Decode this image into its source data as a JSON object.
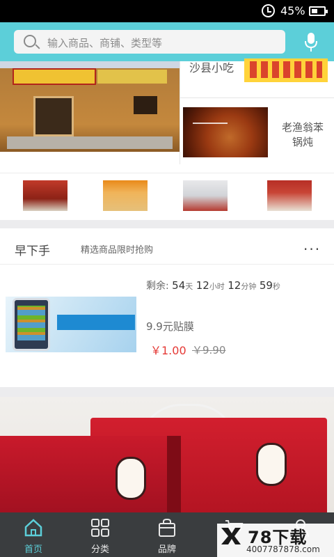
{
  "status_bar": {
    "battery": "45%"
  },
  "search": {
    "placeholder": "输入商品、商铺、类型等"
  },
  "shops": {
    "top_label": "沙县小吃",
    "side_label": "老渔翁苯锅炖"
  },
  "flash_sale": {
    "title": "早下手",
    "subtitle": "精选商品限时抢购",
    "more": "···",
    "countdown": {
      "prefix": "剩余:",
      "days": "54",
      "days_unit": "天",
      "hours": "12",
      "hours_unit": "小时",
      "minutes": "12",
      "minutes_unit": "分钟",
      "seconds": "59",
      "seconds_unit": "秒"
    },
    "product": {
      "name": "9.9元贴膜",
      "price": "￥1.00",
      "old_price": "￥9.90"
    }
  },
  "tabs": [
    {
      "label": "首页",
      "icon": "home-icon",
      "active": true
    },
    {
      "label": "分类",
      "icon": "grid-icon",
      "active": false
    },
    {
      "label": "品牌",
      "icon": "bag-icon",
      "active": false
    },
    {
      "label": "",
      "icon": "cart-icon",
      "active": false
    },
    {
      "label": "",
      "icon": "user-icon",
      "active": false
    }
  ],
  "watermark": {
    "title": "78下载",
    "site": "4007787878.com"
  },
  "colors": {
    "accent": "#5ccfd9",
    "price": "#e53935",
    "tab_bar": "#3a3d3f"
  }
}
